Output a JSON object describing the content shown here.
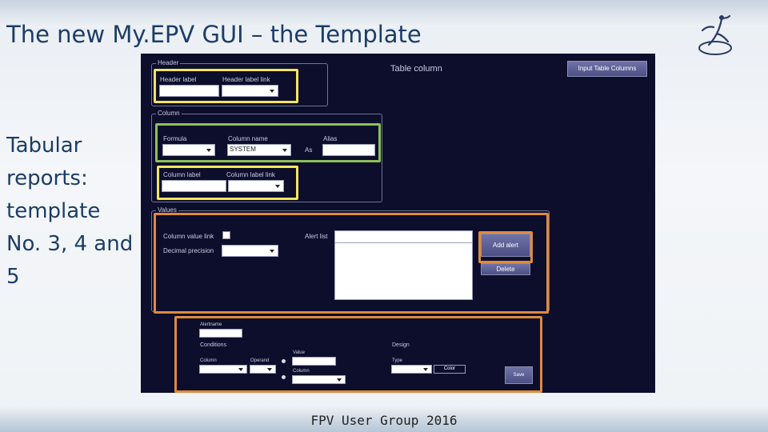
{
  "slide": {
    "title": "The new My.EPV GUI – the Template",
    "side_lines": [
      "Tabular",
      "reports:",
      "template",
      "No. 3, 4 and",
      "5"
    ],
    "footer": "FPV User Group 2016"
  },
  "app": {
    "table_column_title": "Table column",
    "input_table_columns_button": "Input Table Columns",
    "header_group": {
      "title": "Header",
      "header_label": "Header label",
      "header_label_link": "Header label link"
    },
    "column_group": {
      "title": "Column",
      "formula": "Formula",
      "column_name": "Column name",
      "column_name_value": "SYSTEM",
      "as_label": "As",
      "alias": "Alias",
      "column_label": "Column label",
      "column_label_link": "Column label link"
    },
    "values_group": {
      "title": "Values",
      "column_value_link": "Column value link",
      "decimal_precision": "Decimal precision",
      "alert_list": "Alert list",
      "add_alert_button": "Add alert",
      "delete_button": "Delete"
    },
    "alert_editor": {
      "alertname": "Alertname",
      "conditions": "Conditions",
      "column": "Column",
      "operand": "Operand",
      "value": "Value",
      "column2": "Column",
      "design": "Design",
      "type": "Type",
      "color_button": "Color",
      "save_button": "Save"
    }
  },
  "colors": {
    "panel_bg": "#0d0d2c",
    "highlight_yellow": "#f2e45c",
    "highlight_green": "#8cc059",
    "highlight_orange": "#e08a3c",
    "title_color": "#1c3d66"
  },
  "icons": {
    "logo": "dancer-logo-icon"
  }
}
